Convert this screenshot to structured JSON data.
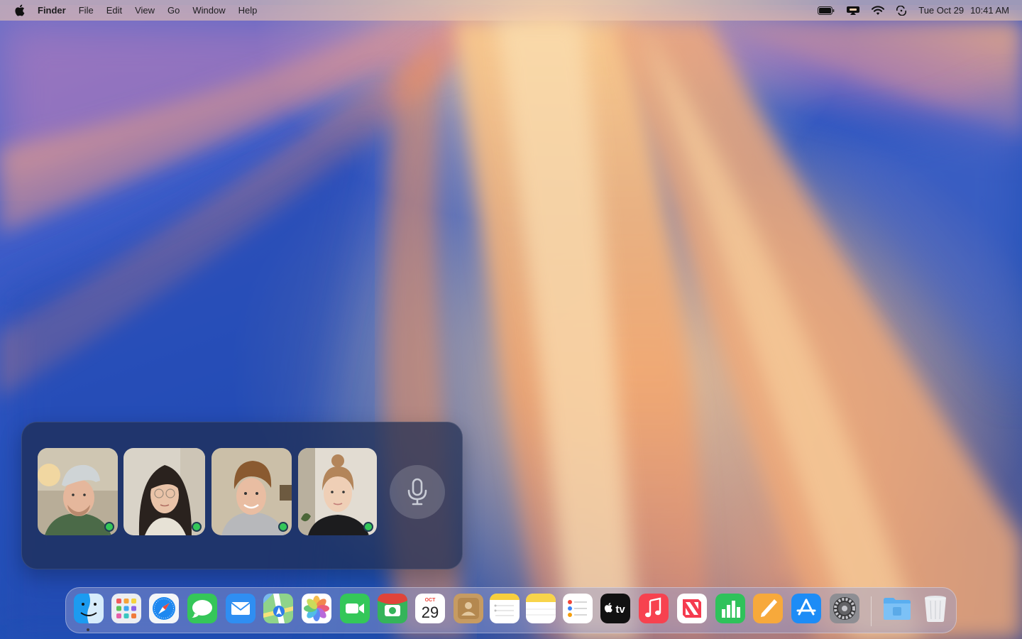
{
  "menubar": {
    "app_name": "Finder",
    "menus": [
      "File",
      "Edit",
      "View",
      "Go",
      "Window",
      "Help"
    ],
    "status_icons": [
      "battery-icon",
      "screen-mirroring-icon",
      "wifi-icon",
      "control-center-icon"
    ],
    "date": "Tue Oct 29",
    "time": "10:41 AM"
  },
  "call_panel": {
    "participants": [
      {
        "name": "participant-1",
        "status": "active",
        "status_color": "#34c759"
      },
      {
        "name": "participant-2",
        "status": "active",
        "status_color": "#34c759"
      },
      {
        "name": "participant-3",
        "status": "active",
        "status_color": "#34c759"
      },
      {
        "name": "participant-4",
        "status": "active",
        "status_color": "#34c759"
      }
    ],
    "mic_icon": "microphone-icon"
  },
  "dock": {
    "apps": [
      {
        "name": "finder",
        "icon": "finder-icon",
        "running": true
      },
      {
        "name": "launchpad",
        "icon": "launchpad-icon",
        "running": false
      },
      {
        "name": "safari",
        "icon": "safari-icon",
        "running": false
      },
      {
        "name": "messages",
        "icon": "messages-icon",
        "running": false
      },
      {
        "name": "mail",
        "icon": "mail-icon",
        "running": false
      },
      {
        "name": "maps",
        "icon": "maps-icon",
        "running": false
      },
      {
        "name": "photos",
        "icon": "photos-icon",
        "running": false
      },
      {
        "name": "facetime",
        "icon": "facetime-icon",
        "running": false
      },
      {
        "name": "photo-booth",
        "icon": "photo-booth-icon",
        "running": false
      },
      {
        "name": "calendar",
        "icon": "calendar-icon",
        "running": false,
        "month": "OCT",
        "day": "29"
      },
      {
        "name": "contacts",
        "icon": "contacts-icon",
        "running": false
      },
      {
        "name": "notes-list",
        "icon": "notes-list-icon",
        "running": false
      },
      {
        "name": "notes",
        "icon": "notes-icon",
        "running": false
      },
      {
        "name": "reminders",
        "icon": "reminders-icon",
        "running": false
      },
      {
        "name": "apple-tv",
        "icon": "apple-tv-icon",
        "running": false,
        "label": "tv"
      },
      {
        "name": "music",
        "icon": "music-icon",
        "running": false
      },
      {
        "name": "news",
        "icon": "news-icon",
        "running": false
      },
      {
        "name": "numbers",
        "icon": "numbers-icon",
        "running": false
      },
      {
        "name": "pages",
        "icon": "pages-icon",
        "running": false
      },
      {
        "name": "app-store",
        "icon": "app-store-icon",
        "running": false
      },
      {
        "name": "system-settings",
        "icon": "gear-icon",
        "running": false
      },
      {
        "name": "downloads-folder",
        "icon": "folder-icon",
        "running": false
      },
      {
        "name": "trash",
        "icon": "trash-icon",
        "running": false
      }
    ]
  }
}
